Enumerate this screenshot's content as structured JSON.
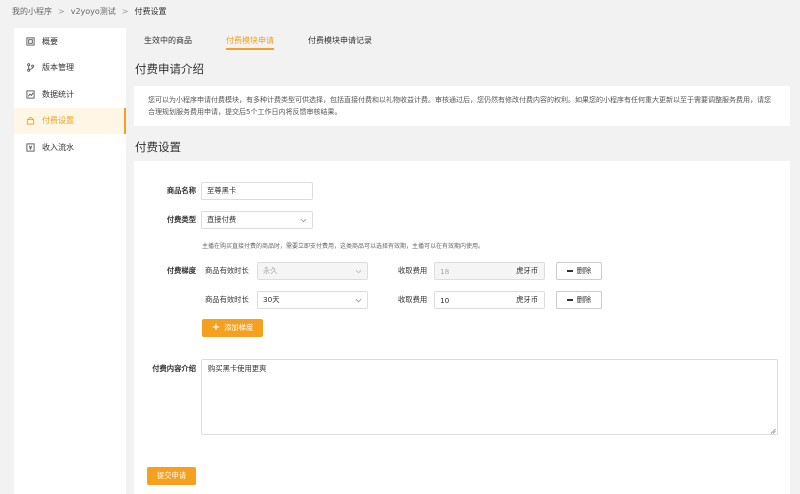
{
  "breadcrumb": {
    "items": [
      "我的小程序",
      "v2yoyo测试",
      "付费设置"
    ],
    "separator": ">"
  },
  "sidebar": {
    "items": [
      {
        "label": "概要",
        "icon": "overview-icon"
      },
      {
        "label": "版本管理",
        "icon": "branch-icon"
      },
      {
        "label": "数据统计",
        "icon": "chart-icon"
      },
      {
        "label": "付费设置",
        "icon": "lock-icon",
        "active": true
      },
      {
        "label": "收入流水",
        "icon": "income-icon"
      }
    ]
  },
  "tabs": [
    {
      "label": "生效中的商品"
    },
    {
      "label": "付费模块申请",
      "active": true
    },
    {
      "label": "付费模块申请记录"
    }
  ],
  "intro": {
    "title": "付费申请介绍",
    "text": "您可以为小程序申请付费模块，有多种计费类型可供选择，包括直接付费和以礼物收益计费。审核通过后，您仍然有修改付费内容的权利。如果您的小程序有任何重大更新以至于需要调整服务费用，请您合理规划服务费用申请，提交后5个工作日内将反馈审核结果。"
  },
  "settings": {
    "title": "付费设置",
    "product_name_label": "商品名称",
    "product_name_value": "至尊黑卡",
    "pay_type_label": "付费类型",
    "pay_type_value": "直接付费",
    "pay_type_hint": "主播在购买直接付费的商品时，需要立即支付费用，这类商品可以选择有效期，主播可以在有效期内使用。",
    "tier_label": "付费梯度",
    "tiers": [
      {
        "validity_label": "商品有效时长",
        "validity_value": "永久",
        "fee_label": "收取费用",
        "fee_value": "18",
        "fee_unit": "虎牙币",
        "delete_label": "删除",
        "disabled": true
      },
      {
        "validity_label": "商品有效时长",
        "validity_value": "30天",
        "fee_label": "收取费用",
        "fee_value": "10",
        "fee_unit": "虎牙币",
        "delete_label": "删除",
        "disabled": false
      }
    ],
    "add_tier_label": "添加梯度",
    "content_label": "付费内容介绍",
    "content_value": "购买黑卡使用更爽",
    "submit_label": "提交申请"
  },
  "colors": {
    "accent": "#f5a01e",
    "background": "#f2f2f2",
    "card": "#ffffff"
  }
}
